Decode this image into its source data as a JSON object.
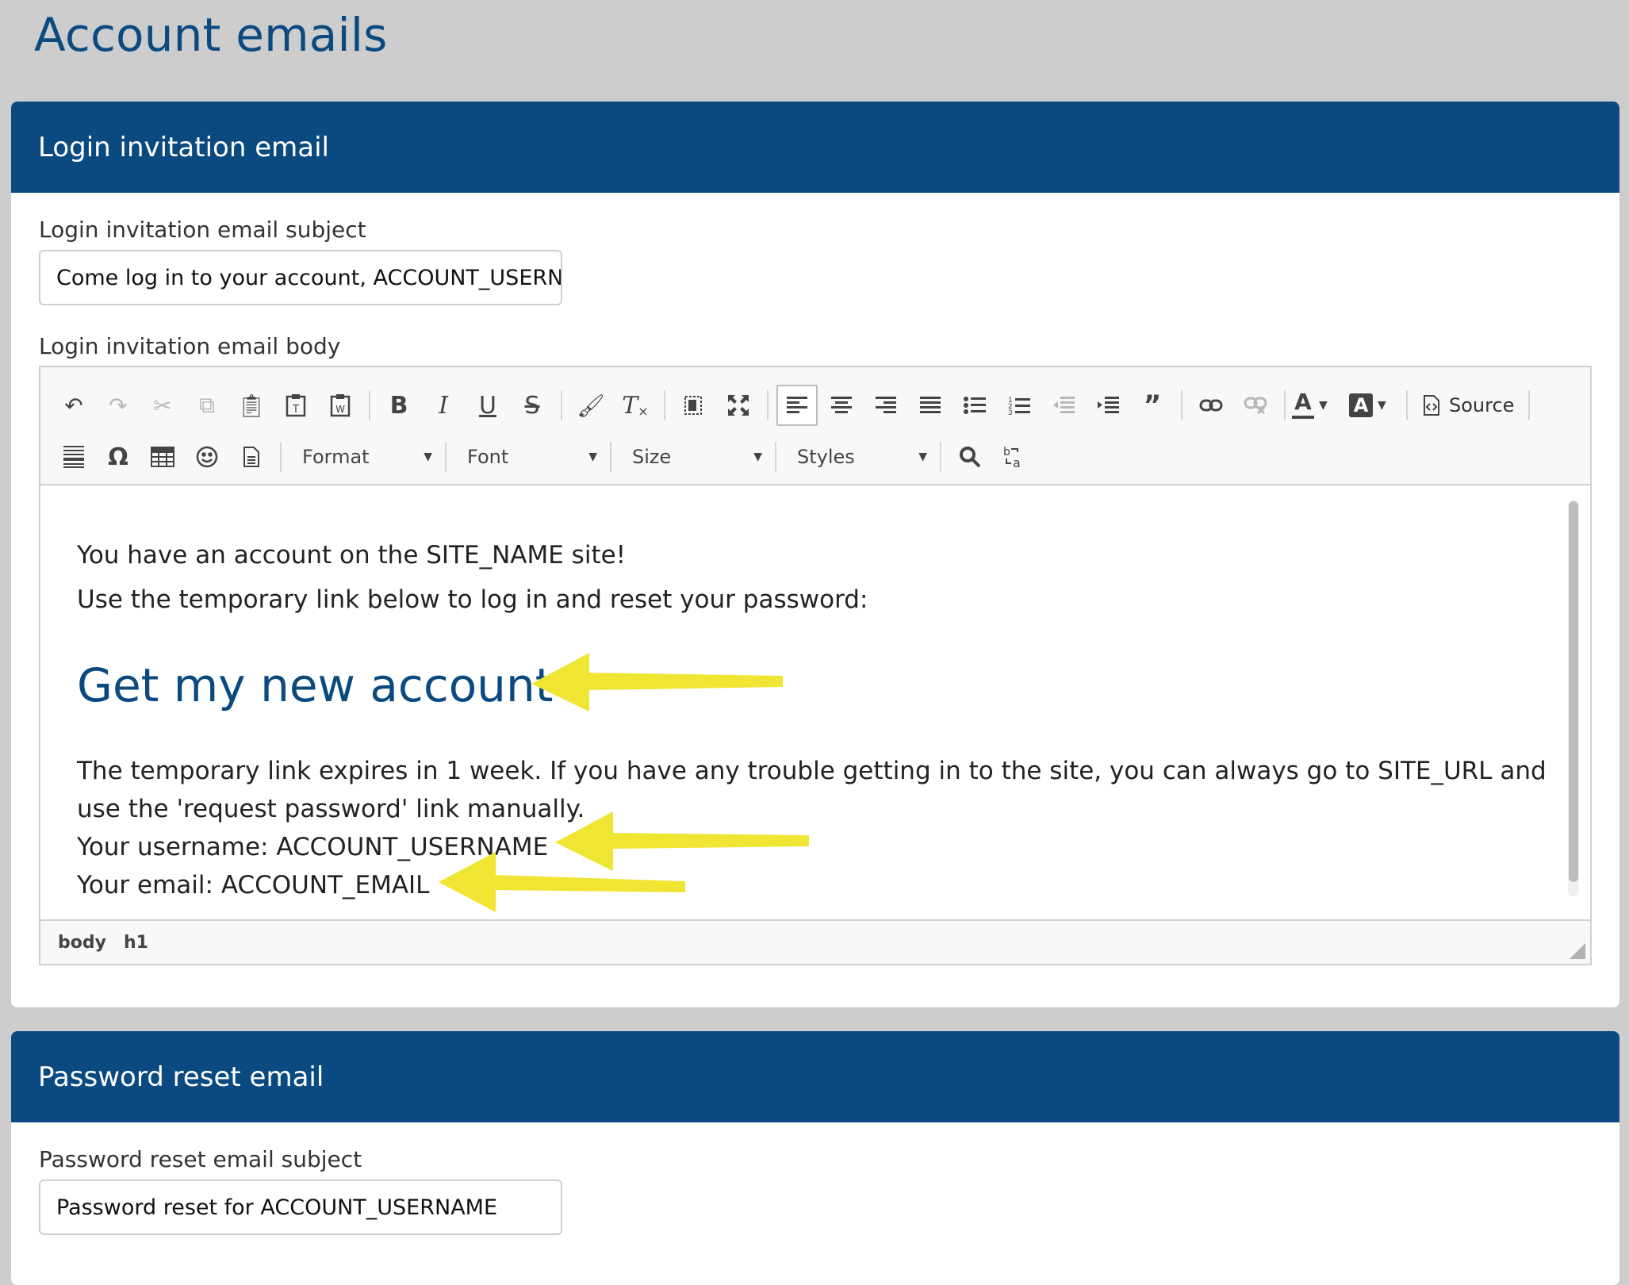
{
  "page": {
    "title": "Account emails"
  },
  "login_panel": {
    "header": "Login invitation email",
    "subject_label": "Login invitation email subject",
    "subject_value": "Come log in to your account, ACCOUNT_USERN",
    "body_label": "Login invitation email body",
    "editor": {
      "toolbar": {
        "source_label": "Source",
        "format_label": "Format",
        "font_label": "Font",
        "size_label": "Size",
        "styles_label": "Styles"
      },
      "content": {
        "line1": "You have an account on the SITE_NAME site!",
        "line2": "Use the temporary link below to log in and reset your password:",
        "link_heading": "Get my new account",
        "line3": "The temporary link expires in 1 week. If you have any trouble getting in to the site, you can always go to SITE_URL and use the 'request password' link manually.",
        "line4": "Your username: ACCOUNT_USERNAME",
        "line5": "Your email: ACCOUNT_EMAIL"
      },
      "path": [
        "body",
        "h1"
      ]
    }
  },
  "reset_panel": {
    "header": "Password reset email",
    "subject_label": "Password reset email subject",
    "subject_value": "Password reset for ACCOUNT_USERNAME"
  },
  "annotation_color": "#f1e534",
  "brand_color": "#0b4a80"
}
